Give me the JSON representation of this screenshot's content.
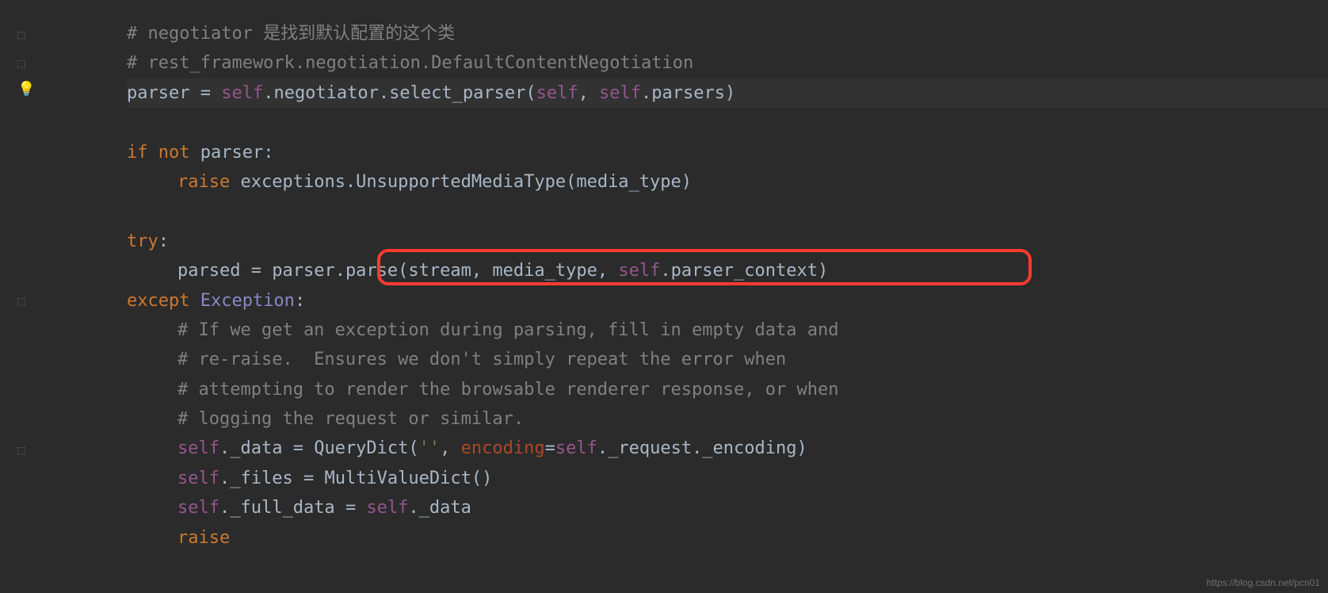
{
  "gutter": {
    "bulb_icon": "💡",
    "bookmark_icon": "⬚"
  },
  "code": {
    "l1_comment": "# negotiator 是找到默认配置的这个类",
    "l2_comment": "# rest_framework.negotiation.DefaultContentNegotiation",
    "l3_parser": "parser ",
    "l3_eq": "= ",
    "l3_self1": "self",
    "l3_dot1": ".negotiator.select_parser(",
    "l3_self2": "self",
    "l3_comma": ", ",
    "l3_self3": "self",
    "l3_dot2": ".parsers)",
    "l4_empty": "",
    "l5_if": "if not ",
    "l5_parser": "parser:",
    "l6_raise": "raise ",
    "l6_exc": "exceptions.UnsupportedMediaType(media_type)",
    "l7_empty": "",
    "l8_try": "try",
    "l8_colon": ":",
    "l9_parsed": "parsed ",
    "l9_eq": "= ",
    "l9_parser": "parser.",
    "l9_parse": "parse",
    "l9_open": "(stream",
    "l9_comma1": ", ",
    "l9_media": "media_type",
    "l9_comma2": ", ",
    "l9_self": "self",
    "l9_rest": ".parser_context)",
    "l10_except": "except ",
    "l10_exception": "Exception",
    "l10_colon": ":",
    "l11_comment": "# If we get an exception during parsing, fill in empty data and",
    "l12_comment": "# re-raise.  Ensures we don't simply repeat the error when",
    "l13_comment": "# attempting to render the browsable renderer response, or when",
    "l14_comment": "# logging the request or similar.",
    "l15_self": "self",
    "l15_data": "._data ",
    "l15_eq": "= ",
    "l15_qd": "QueryDict(",
    "l15_str": "''",
    "l15_comma": ", ",
    "l15_enc": "encoding",
    "l15_eq2": "=",
    "l15_self2": "self",
    "l15_rest": "._request._encoding)",
    "l16_self": "self",
    "l16_files": "._files ",
    "l16_eq": "= ",
    "l16_mvd": "MultiValueDict()",
    "l17_self": "self",
    "l17_full": "._full_data ",
    "l17_eq": "= ",
    "l17_self2": "self",
    "l17_data": "._data",
    "l18_raise": "raise"
  },
  "watermark": "https://blog.csdn.net/pcn01"
}
